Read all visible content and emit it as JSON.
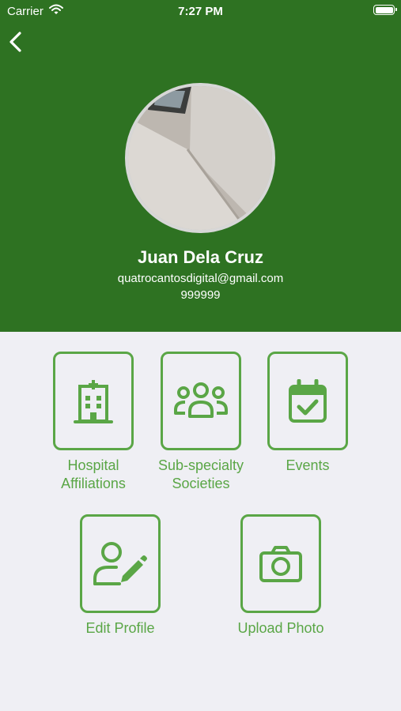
{
  "status_bar": {
    "carrier": "Carrier",
    "time": "7:27 PM"
  },
  "profile": {
    "name": "Juan Dela Cruz",
    "email": "quatrocantosdigital@gmail.com",
    "phone": "999999"
  },
  "menu": [
    {
      "label": "Hospital Affiliations",
      "icon": "hospital-icon"
    },
    {
      "label": "Sub-specialty Societies",
      "icon": "users-group-icon"
    },
    {
      "label": "Events",
      "icon": "calendar-check-icon"
    },
    {
      "label": "Edit Profile",
      "icon": "user-edit-icon"
    },
    {
      "label": "Upload Photo",
      "icon": "camera-icon"
    }
  ],
  "colors": {
    "header": "#2e7222",
    "accent": "#5aa646",
    "background": "#efeff4"
  }
}
